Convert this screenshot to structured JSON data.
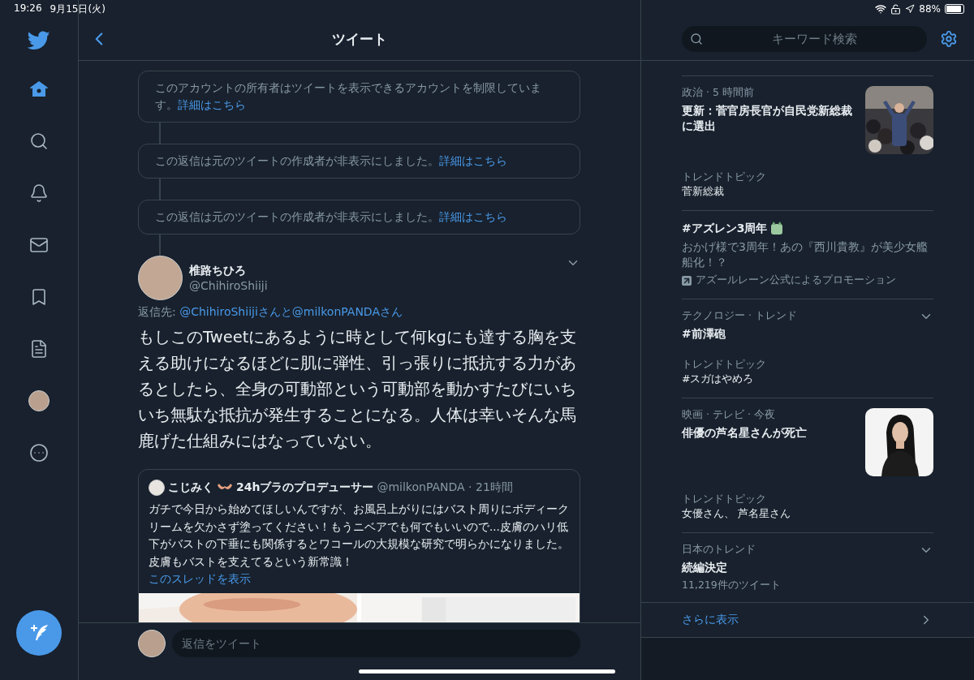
{
  "status_bar": {
    "time": "19:26",
    "date": "9月15日(火)",
    "battery": "88%"
  },
  "nav": [
    {
      "kind": "home",
      "selected": true
    },
    {
      "kind": "search",
      "selected": false
    },
    {
      "kind": "notifications",
      "selected": false
    },
    {
      "kind": "messages",
      "selected": false
    },
    {
      "kind": "bookmarks",
      "selected": false
    },
    {
      "kind": "lists",
      "selected": false
    },
    {
      "kind": "profile",
      "selected": false
    },
    {
      "kind": "more",
      "selected": false
    }
  ],
  "header": {
    "title": "ツイート"
  },
  "notices": [
    {
      "text": "このアカウントの所有者はツイートを表示できるアカウントを制限しています。",
      "link": "詳細はこちら"
    },
    {
      "text": "この返信は元のツイートの作成者が非表示にしました。",
      "link": "詳細はこちら"
    },
    {
      "text": "この返信は元のツイートの作成者が非表示にしました。",
      "link": "詳細はこちら"
    }
  ],
  "tweet": {
    "name": "椎路ちひろ",
    "handle": "@ChihiroShiiji",
    "reply_label": "返信先:",
    "reply_to": "@ChihiroShiijiさんと@milkonPANDAさん",
    "text": "もしこのTweetにあるように時として何kgにも達する胸を支える助けになるほどに肌に弾性、引っ張りに抵抗する力があるとしたら、全身の可動部という可動部を動かすたびにいちいち無駄な抵抗が発生することになる。人体は幸いそんな馬鹿げた仕組みにはなっていない。",
    "quote": {
      "name_start": "こじみく",
      "name_end": "24hブラのプロデューサー",
      "handle": "@milkonPANDA · 21時間",
      "text": "ガチで今日から始めてほしいんですが、お風呂上がりにはバスト周りにボディークリームを欠かさず塗ってください！もうニベアでも何でもいいので...皮膚のハリ低下がバストの下垂にも関係するとワコールの大規模な研究で明らかになりました。皮膚もバストを支えてるという新常識！",
      "thread_link": "このスレッドを表示"
    }
  },
  "reply_bar": {
    "placeholder": "返信をツイート"
  },
  "search": {
    "placeholder": "キーワード検索"
  },
  "trends": [
    {
      "kind": "news",
      "meta": "政治 · 5 時間前",
      "title": "更新：菅官房長官が自民党新総裁に選出",
      "has_menu": false,
      "topic_label": "トレンドトピック",
      "topic": "菅新総裁"
    },
    {
      "kind": "promoted",
      "title": "#アズレン3周年",
      "has_menu": false,
      "description": "おかげ様で3周年！あの『西川貴教』が美少女艦船化！？",
      "promoter": "アズールレーン公式によるプロモーション"
    },
    {
      "kind": "trend",
      "meta": "テクノロジー · トレンド",
      "title": "#前澤砲",
      "has_menu": true,
      "topic_label": "トレンドトピック",
      "topic": "#スガはやめろ"
    },
    {
      "kind": "news",
      "meta": "映画 · テレビ · 今夜",
      "title": "俳優の芦名星さんが死亡",
      "has_menu": false,
      "topic_label": "トレンドトピック",
      "topic": "女優さん、 芦名星さん"
    },
    {
      "kind": "trend",
      "meta": "日本のトレンド",
      "title": "続編決定",
      "has_menu": true,
      "count": "11,219件のツイート"
    }
  ],
  "show_more": "さらに表示"
}
